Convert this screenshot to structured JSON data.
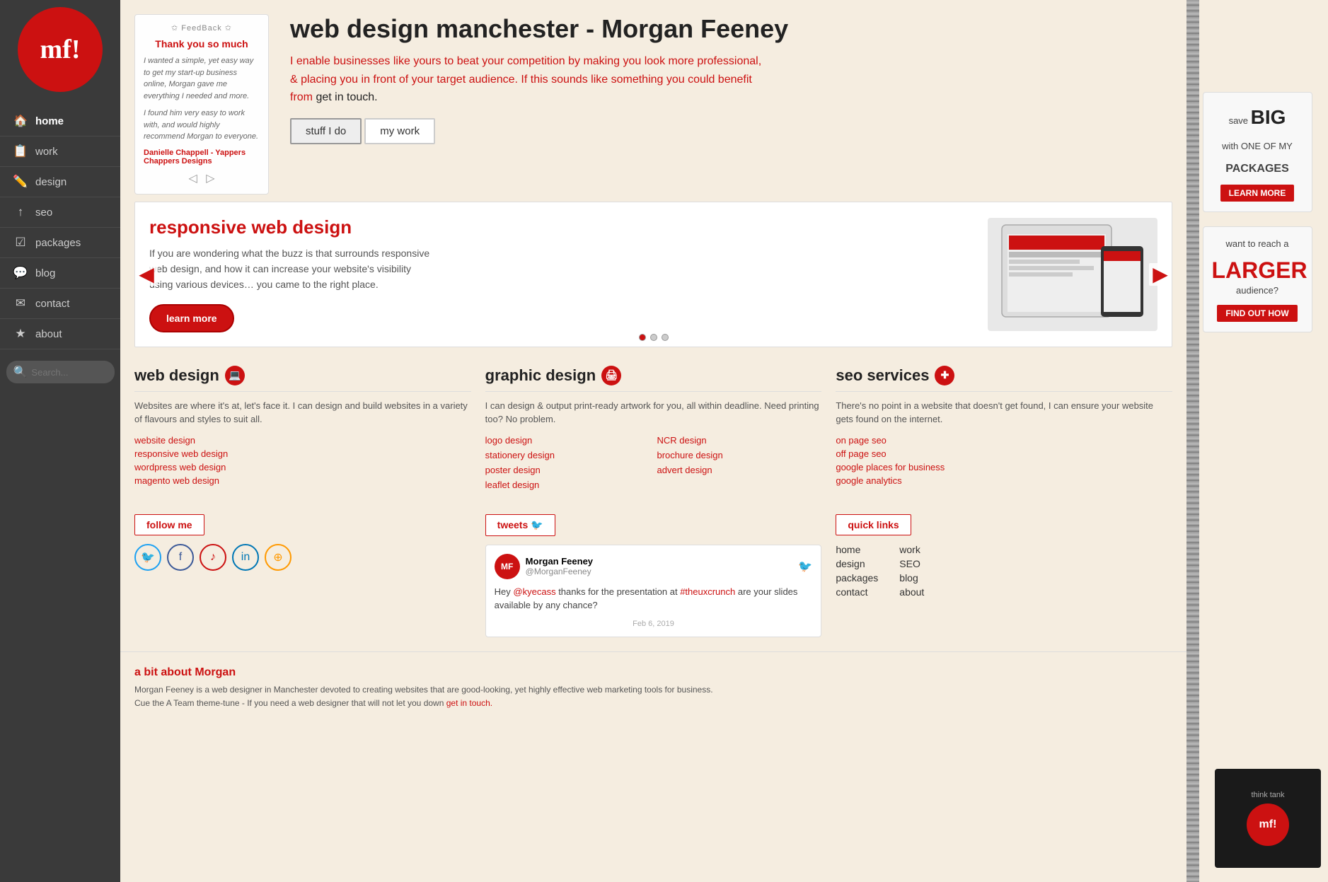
{
  "sidebar": {
    "logo_text": "mf!",
    "nav_items": [
      {
        "label": "home",
        "icon": "home-icon",
        "active": true
      },
      {
        "label": "work",
        "icon": "work-icon"
      },
      {
        "label": "design",
        "icon": "design-icon"
      },
      {
        "label": "seo",
        "icon": "seo-icon"
      },
      {
        "label": "packages",
        "icon": "packages-icon"
      },
      {
        "label": "blog",
        "icon": "blog-icon"
      },
      {
        "label": "contact",
        "icon": "contact-icon"
      },
      {
        "label": "about",
        "icon": "about-icon"
      }
    ],
    "search_placeholder": "Search..."
  },
  "feedback": {
    "header": "✩ FeedBack ✩",
    "title": "Thank you so much",
    "text1": "I wanted a simple, yet easy way to get my start-up business online, Morgan gave me everything I needed and more.",
    "text2": "I found him very easy to work with, and would highly recommend Morgan to everyone.",
    "author": "Danielle Chappell - Yappers Chappers Designs"
  },
  "hero": {
    "title": "web design manchester - Morgan Feeney",
    "desc_red": "I enable businesses like yours to beat your competition by making you look more professional, & placing you in front of your target audience. If this sounds like something you could benefit from",
    "desc_black": "get in touch.",
    "tab_stuff": "stuff I do",
    "tab_work": "my work"
  },
  "slider": {
    "title": "responsive web design",
    "text": "If you are wondering what the buzz is that surrounds responsive web design, and how it can increase your website's visibility using various devices… you came to the right place.",
    "learn_more": "learn more",
    "dots": 3,
    "active_dot": 0
  },
  "services": {
    "web_design": {
      "title": "web design",
      "icon": "💻",
      "desc": "Websites are where it's at, let's face it. I can design and build websites in a variety of flavours and styles to suit all.",
      "links": [
        {
          "label": "website design"
        },
        {
          "label": "responsive web design"
        },
        {
          "label": "wordpress web design"
        },
        {
          "label": "magento web design"
        }
      ]
    },
    "graphic_design": {
      "title": "graphic design",
      "icon": "🖨",
      "desc": "I can design & output print-ready artwork for you, all within deadline. Need printing too? No problem.",
      "links_col1": [
        {
          "label": "logo design"
        },
        {
          "label": "stationery design"
        },
        {
          "label": "poster design"
        },
        {
          "label": "leaflet design"
        }
      ],
      "links_col2": [
        {
          "label": "NCR design"
        },
        {
          "label": "brochure design"
        },
        {
          "label": "advert design"
        }
      ]
    },
    "seo": {
      "title": "seo services",
      "icon": "🔴",
      "desc": "There's no point in a website that doesn't get found, I can ensure your website gets found on the internet.",
      "links": [
        {
          "label": "on page seo"
        },
        {
          "label": "off page seo"
        },
        {
          "label": "google places for business"
        },
        {
          "label": "google analytics"
        }
      ]
    }
  },
  "follow": {
    "title": "follow me"
  },
  "tweets": {
    "title": "tweets 🐦",
    "author": "Morgan Feeney",
    "handle": "@MorganFeeney",
    "text": "Hey @kyecass thanks for the presentation at #theuxcrunch are your slides available by any chance?",
    "date": "Feb 6, 2019"
  },
  "quick_links": {
    "title": "quick links",
    "col1": [
      "home",
      "design",
      "packages",
      "contact"
    ],
    "col2": [
      "work",
      "SEO",
      "blog",
      "about"
    ]
  },
  "about": {
    "title": "a bit about Morgan",
    "text1": "Morgan Feeney is a web designer in Manchester devoted to creating websites that are good-looking, yet highly effective web marketing tools for business.",
    "text2": "Cue the A Team theme-tune - If you need a web designer that will not let you down",
    "link": "get in touch."
  },
  "right_promo": {
    "box1": {
      "text1": "save",
      "big": "BIG",
      "text2": "with ONE OF MY",
      "text3": "PACKAGES",
      "btn": "LEARN MORE"
    },
    "box2": {
      "text1": "want to reach a",
      "big": "LARGER",
      "text2": "audience?",
      "btn": "FIND OUT HOW"
    },
    "thinktank": {
      "label": "think tank",
      "logo": "mf!"
    }
  }
}
